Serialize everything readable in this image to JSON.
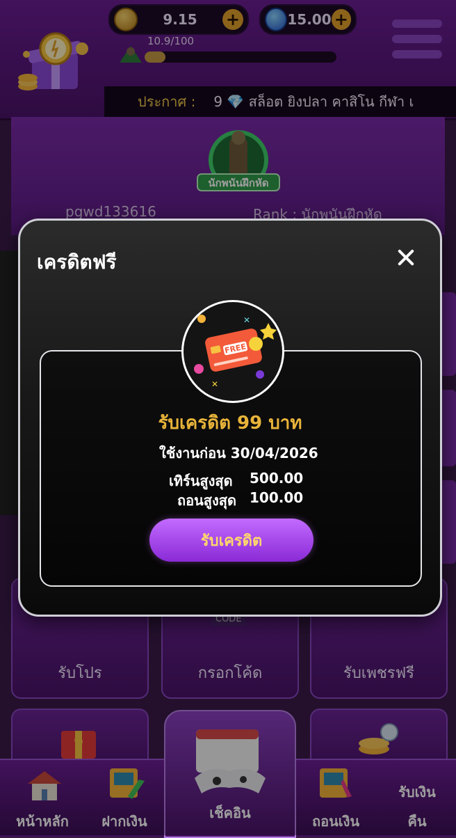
{
  "header": {
    "coin_balance": "9.15",
    "gem_balance": "15.00",
    "xp_text": "10.9/100",
    "xp_progress": 0.109,
    "announce_label": "ประกาศ :",
    "announce_text": "9 💎 สล็อต ยิงปลา คาสิโน กีฬา เ"
  },
  "profile": {
    "rank_badge_text": "นักพนันฝึกหัด",
    "username": "pgwd133616",
    "rank_text": "Rank : นักพนันฝึกหัด"
  },
  "tiles": {
    "promo": "รับโปร",
    "code": "กรอกโค้ด",
    "diamond": "รับเพชรฟรี",
    "code_icon_text": "CODE"
  },
  "bottom_nav": {
    "home": "หน้าหลัก",
    "deposit": "ฝากเงิน",
    "checkin": "เช็คอิน",
    "withdraw": "ถอนเงิน",
    "refund_line1": "รับเงิน",
    "refund_line2": "คืน"
  },
  "modal": {
    "title": "เครดิตฟรี",
    "coupon_label": "FREE",
    "reward_title": "รับเครดิต 99 บาท",
    "use_before": "ใช้งานก่อน 30/04/2026",
    "max_turnover_label": "เทิร์นสูงสุด",
    "max_turnover_value": "500.00",
    "max_withdraw_label": "ถอนสูงสุด",
    "max_withdraw_value": "100.00",
    "claim_button": "รับเครดิต"
  },
  "colors": {
    "accent_gold": "#e9b43a",
    "button_purple": "#a447f0",
    "app_purple": "#6b1d93"
  },
  "icons": {
    "coin": "coin-icon",
    "gem": "gem-icon",
    "plus": "plus-icon",
    "menu": "hamburger-menu-icon",
    "close": "close-icon",
    "coupon": "credit-card-free-icon",
    "gift": "gift-box-clock-icon"
  }
}
